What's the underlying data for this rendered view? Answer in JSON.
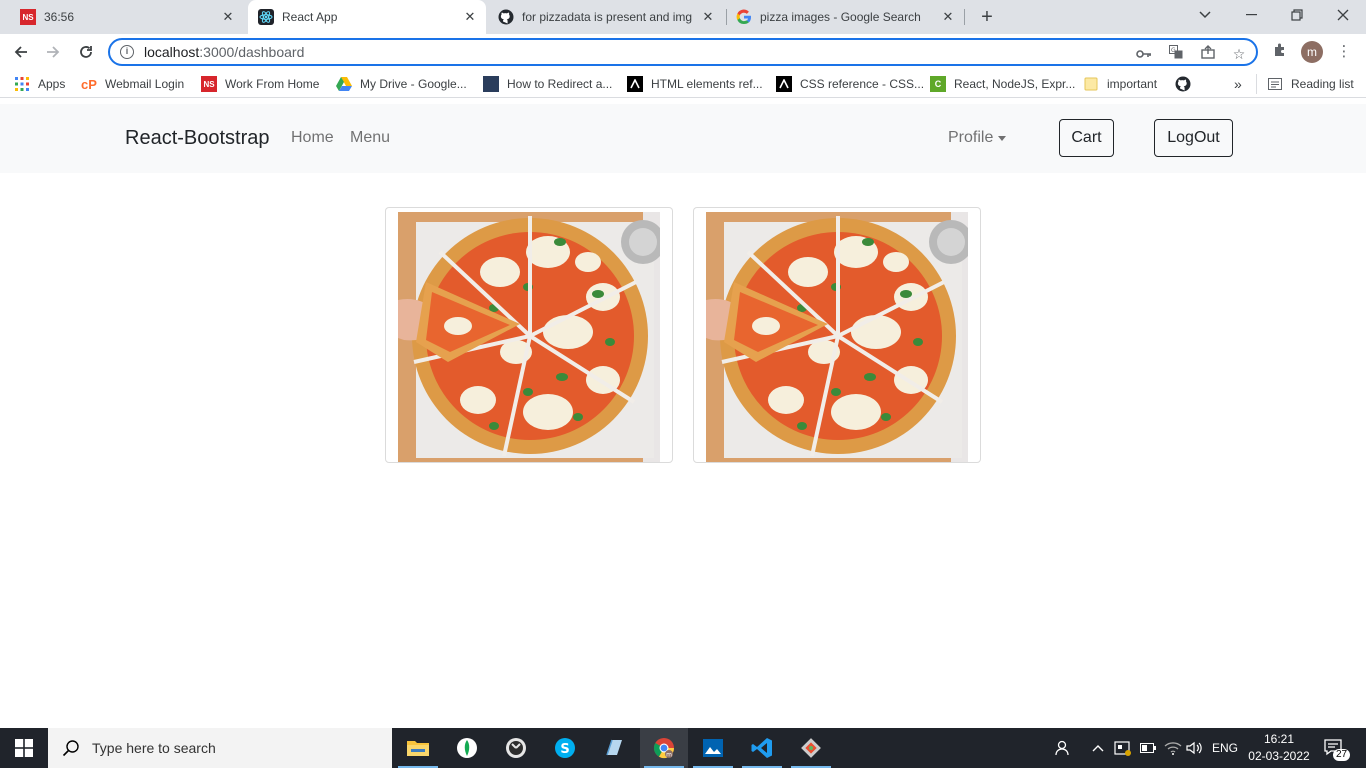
{
  "browser": {
    "tabs": [
      {
        "title": "36:56",
        "icon": "ns-icon"
      },
      {
        "title": "React App",
        "icon": "react-icon",
        "active": true
      },
      {
        "title": "for pizzadata is present and img",
        "icon": "github-icon"
      },
      {
        "title": "pizza images - Google Search",
        "icon": "google-icon"
      }
    ],
    "url_host": "localhost",
    "url_path": ":3000/dashboard",
    "bookmarks": [
      {
        "label": "Apps",
        "icon": "apps-grid-icon"
      },
      {
        "label": "Webmail Login",
        "icon": "cpanel-icon"
      },
      {
        "label": "Work From Home",
        "icon": "ns-icon"
      },
      {
        "label": "My Drive - Google...",
        "icon": "drive-icon"
      },
      {
        "label": "How to Redirect a...",
        "icon": "site-icon"
      },
      {
        "label": "HTML elements ref...",
        "icon": "mdn-icon"
      },
      {
        "label": "CSS reference - CSS...",
        "icon": "mdn-icon"
      },
      {
        "label": "React, NodeJS, Expr...",
        "icon": "site-icon"
      },
      {
        "label": "important",
        "icon": "folder-icon"
      }
    ],
    "reading_list": "Reading list",
    "more_bookmarks": "»",
    "profile_initial": "m"
  },
  "app": {
    "brand": "React-Bootstrap",
    "nav": {
      "home": "Home",
      "menu": "Menu"
    },
    "profile": "Profile",
    "cart": "Cart",
    "logout": "LogOut",
    "cards": [
      {
        "image": "pizza-margherita-image"
      },
      {
        "image": "pizza-margherita-image"
      }
    ]
  },
  "taskbar": {
    "search_placeholder": "Type here to search",
    "language": "ENG",
    "time": "16:21",
    "date": "02-03-2022",
    "notifications": "27"
  },
  "colors": {
    "tab_strip": "#dee1e6",
    "omnibox_focus": "#1a73e8",
    "navbar_bg": "#f8f9fa",
    "taskbar_bg": "#20242b"
  }
}
